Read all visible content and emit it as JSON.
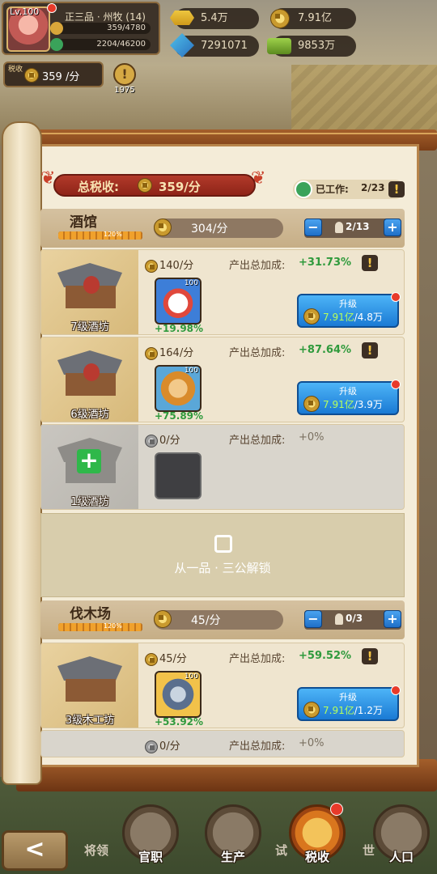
{
  "hud": {
    "level": "Lv.100",
    "rank": "正三品 · 州牧 (14)",
    "exp": "359/4780",
    "pop": "2204/46200",
    "tax_label": "税收",
    "tax_rate": "359 /分",
    "tip_count": "1975"
  },
  "resources": [
    {
      "icon": "gold-ingot-icon",
      "value": "5.4万"
    },
    {
      "icon": "coin-icon",
      "value": "7.91亿"
    },
    {
      "icon": "power-icon",
      "value": "7291071"
    },
    {
      "icon": "cash-icon",
      "value": "9853万"
    }
  ],
  "summary": {
    "total_label": "总税收:",
    "total_value": "359/分",
    "worked_label": "已工作:",
    "worked_value": "2/23"
  },
  "categories": [
    {
      "name": "酒馆",
      "pct": "120%",
      "rate": "304/分",
      "count": "2/13",
      "level_fill": 1.0
    },
    {
      "name": "伐木场",
      "pct": "120%",
      "rate": "45/分",
      "count": "0/3",
      "level_fill": 1.0
    }
  ],
  "bonus_label": "产出总加成:",
  "rows": [
    {
      "name": "7级酒坊",
      "income": "140/分",
      "bonus": "+31.73%",
      "hero_level": "100",
      "hero_bonus": "+19.98%",
      "upgrade_label": "升级",
      "cost": "7.91亿",
      "cost_need": "/4.8万"
    },
    {
      "name": "6级酒坊",
      "income": "164/分",
      "bonus": "+87.64%",
      "hero_level": "100",
      "hero_bonus": "+75.89%",
      "upgrade_label": "升级",
      "cost": "7.91亿",
      "cost_need": "/3.9万"
    },
    {
      "name": "1级酒坊",
      "income": "0/分",
      "bonus": "+0%"
    },
    {
      "name": "3级木工坊",
      "income": "45/分",
      "bonus": "+59.52%",
      "hero_level": "100",
      "hero_bonus": "+53.92%",
      "upgrade_label": "升级",
      "cost": "7.91亿",
      "cost_need": "/1.2万"
    },
    {
      "income": "0/分",
      "bonus": "+0%"
    }
  ],
  "unlock_text": "从一品 · 三公解锁",
  "nav": {
    "back": "<",
    "items": [
      "将领",
      "官职",
      "生产",
      "试",
      "税收",
      "世",
      "人口"
    ]
  }
}
